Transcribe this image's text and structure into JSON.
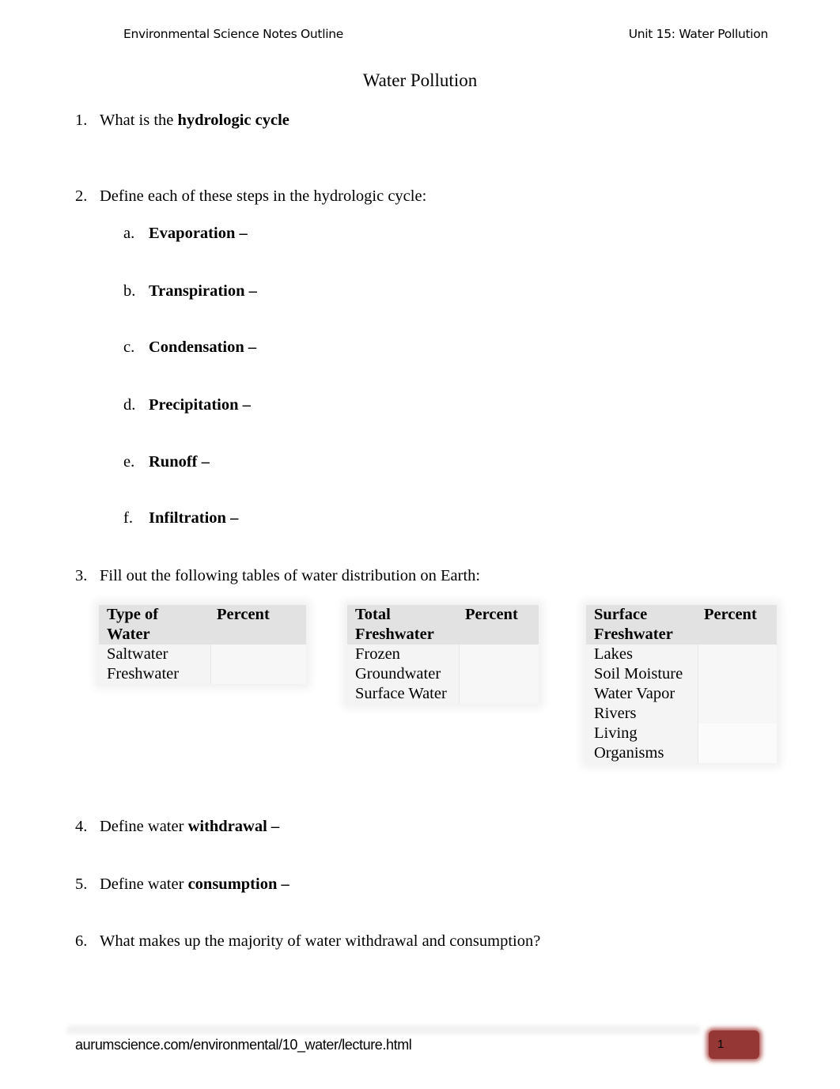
{
  "header": {
    "left": "Environmental Science Notes Outline",
    "right": "Unit 15: Water Pollution"
  },
  "title": "Water Pollution",
  "questions": [
    {
      "num": "1.",
      "text": "What is the ",
      "bold": "hydrologic cycle",
      "after": ""
    },
    {
      "num": "2.",
      "text": "Define each of these steps in the hydrologic cycle:",
      "bold": "",
      "after": ""
    },
    {
      "num": "3.",
      "text": "Fill out the following tables of water distribution on Earth:",
      "bold": "",
      "after": ""
    },
    {
      "num": "4.",
      "text": "Define water ",
      "bold": "withdrawal –",
      "after": ""
    },
    {
      "num": "5.",
      "text": "Define water ",
      "bold": "consumption –",
      "after": ""
    },
    {
      "num": "6.",
      "text": "What makes up the majority of water withdrawal and consumption?",
      "bold": "",
      "after": ""
    }
  ],
  "steps": [
    {
      "letter": "a.",
      "term": "Evaporation –"
    },
    {
      "letter": "b.",
      "term": "Transpiration –"
    },
    {
      "letter": "c.",
      "term": "Condensation –"
    },
    {
      "letter": "d.",
      "term": "Precipitation –"
    },
    {
      "letter": "e.",
      "term": "Runoff –"
    },
    {
      "letter": "f.",
      "term": "Infiltration –"
    }
  ],
  "tables": [
    {
      "header": [
        "Type of",
        "Water"
      ],
      "percent_label": "Percent",
      "rows": [
        "Saltwater",
        "Freshwater"
      ],
      "values": [
        "",
        ""
      ]
    },
    {
      "header": [
        "Total",
        "Freshwater"
      ],
      "percent_label": "Percent",
      "rows": [
        "Frozen",
        "Groundwater",
        "Surface Water"
      ],
      "values": [
        "",
        "",
        ""
      ]
    },
    {
      "header": [
        "Surface",
        "Freshwater"
      ],
      "percent_label": "Percent",
      "rows": [
        "Lakes",
        "Soil Moisture",
        "Water Vapor",
        "Rivers",
        "Living",
        "Organisms"
      ],
      "values": [
        "",
        "",
        "",
        "",
        "",
        ""
      ]
    }
  ],
  "footer": {
    "url": "aurumscience.com/environmental/10_water/lecture.html",
    "page_number": "1",
    "badge_color": "#953735"
  }
}
